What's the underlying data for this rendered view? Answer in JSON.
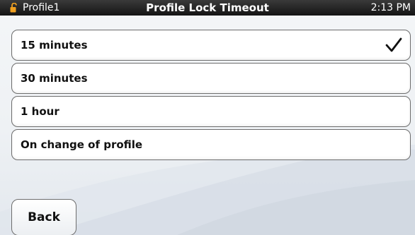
{
  "status_bar": {
    "profile_name": "Profile1",
    "title": "Profile Lock Timeout",
    "time": "2:13 PM",
    "lock_icon": "unlocked-padlock-icon",
    "lock_color": "#f0a020"
  },
  "options": [
    {
      "label": "15 minutes",
      "selected": true
    },
    {
      "label": "30 minutes",
      "selected": false
    },
    {
      "label": "1 hour",
      "selected": false
    },
    {
      "label": "On change of profile",
      "selected": false
    }
  ],
  "selected_icon": "checkmark-icon",
  "back_button": {
    "label": "Back"
  }
}
